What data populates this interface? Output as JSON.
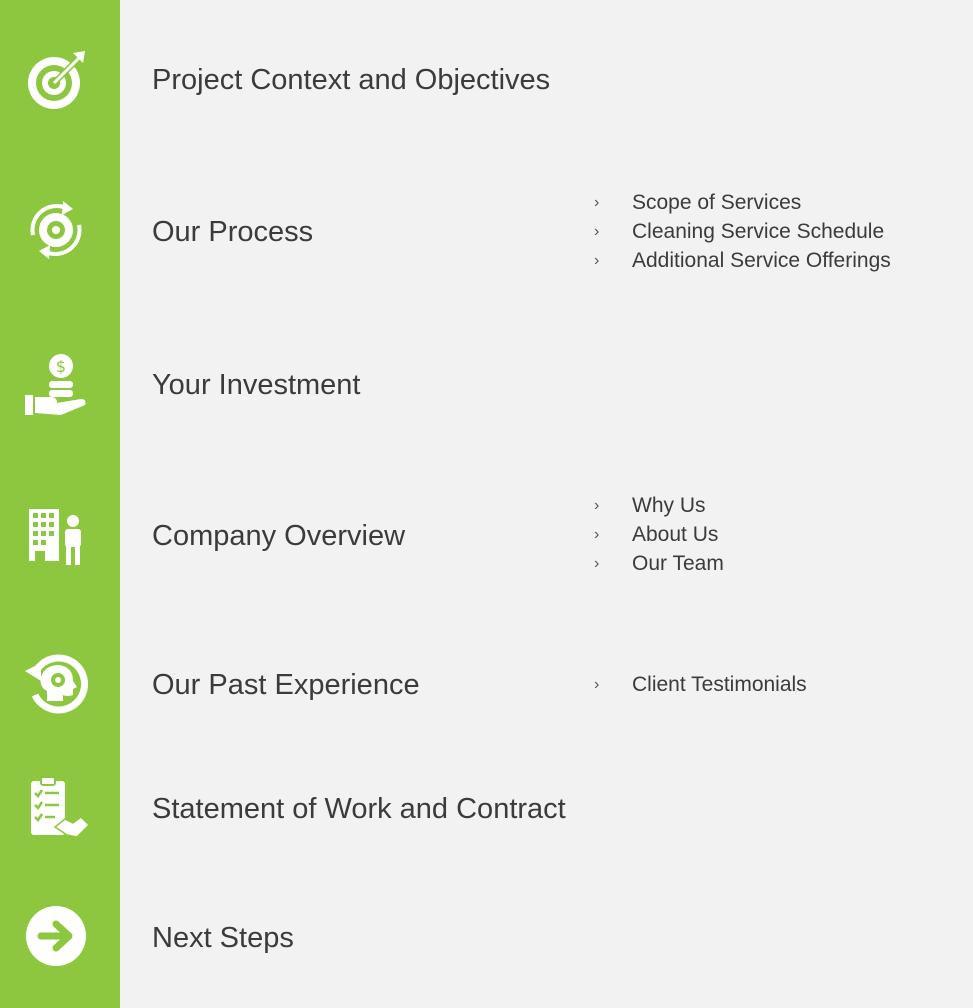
{
  "colors": {
    "sidebar": "#8dc63f",
    "background": "#f2f2f2",
    "text": "#3b3b3b",
    "icon": "#ffffff"
  },
  "sections": [
    {
      "label": "Project Context and Objectives",
      "icon": "target-icon"
    },
    {
      "label": "Our Process",
      "icon": "gear-cycle-icon",
      "subitems": [
        "Scope of Services",
        "Cleaning Service Schedule",
        "Additional Service Offerings"
      ]
    },
    {
      "label": "Your Investment",
      "icon": "hand-coins-icon"
    },
    {
      "label": "Company Overview",
      "icon": "building-person-icon",
      "subitems": [
        "Why Us",
        "About Us",
        "Our Team"
      ]
    },
    {
      "label": "Our Past Experience",
      "icon": "head-history-icon",
      "subitems": [
        "Client Testimonials"
      ]
    },
    {
      "label": "Statement of Work and Contract",
      "icon": "checklist-handshake-icon"
    },
    {
      "label": "Next Steps",
      "icon": "arrow-right-icon"
    }
  ],
  "bullet_glyph": "›"
}
